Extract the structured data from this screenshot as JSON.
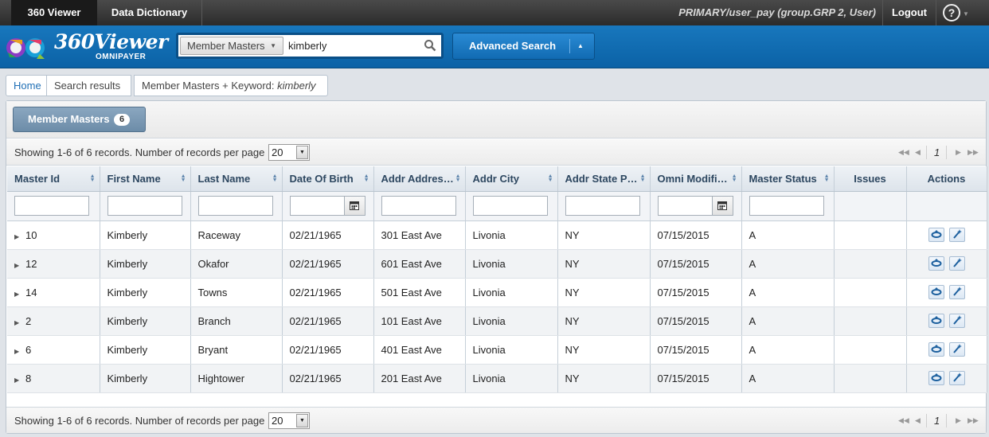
{
  "topbar": {
    "tabs": [
      {
        "label": "360 Viewer"
      },
      {
        "label": "Data Dictionary"
      }
    ],
    "user": "PRIMARY/user_pay (group.GRP 2, User)",
    "logout": "Logout",
    "help_icon": "question-circle-icon"
  },
  "brand": {
    "name": "360Viewer",
    "sub": "OMNIPAYER",
    "colors": {
      "header_blue": "#0f6db4",
      "accent": "#1877bd"
    }
  },
  "search": {
    "scope": "Member Masters",
    "value": "kimberly",
    "placeholder": ""
  },
  "advanced_search": {
    "label": "Advanced Search"
  },
  "breadcrumb": [
    {
      "label": "Home"
    },
    {
      "label": "Search results"
    },
    {
      "label": "Member Masters + Keyword: ",
      "keyword": "kimberly"
    }
  ],
  "tab": {
    "label": "Member Masters",
    "count": "6"
  },
  "pager": {
    "text": "Showing 1-6 of 6 records. Number of records per page",
    "per_page": "20",
    "page": "1"
  },
  "table": {
    "columns": [
      "Master Id",
      "First Name",
      "Last Name",
      "Date Of Birth",
      "Addr Addres…",
      "Addr City",
      "Addr State P…",
      "Omni Modifi…",
      "Master Status",
      "Issues",
      "Actions"
    ],
    "rows": [
      {
        "id": "10",
        "first": "Kimberly",
        "last": "Raceway",
        "dob": "02/21/1965",
        "addr": "301 East Ave",
        "city": "Livonia",
        "state": "NY",
        "modified": "07/15/2015",
        "status": "A",
        "issues": ""
      },
      {
        "id": "12",
        "first": "Kimberly",
        "last": "Okafor",
        "dob": "02/21/1965",
        "addr": "601 East Ave",
        "city": "Livonia",
        "state": "NY",
        "modified": "07/15/2015",
        "status": "A",
        "issues": ""
      },
      {
        "id": "14",
        "first": "Kimberly",
        "last": "Towns",
        "dob": "02/21/1965",
        "addr": "501 East Ave",
        "city": "Livonia",
        "state": "NY",
        "modified": "07/15/2015",
        "status": "A",
        "issues": ""
      },
      {
        "id": "2",
        "first": "Kimberly",
        "last": "Branch",
        "dob": "02/21/1965",
        "addr": "101 East Ave",
        "city": "Livonia",
        "state": "NY",
        "modified": "07/15/2015",
        "status": "A",
        "issues": ""
      },
      {
        "id": "6",
        "first": "Kimberly",
        "last": "Bryant",
        "dob": "02/21/1965",
        "addr": "401 East Ave",
        "city": "Livonia",
        "state": "NY",
        "modified": "07/15/2015",
        "status": "A",
        "issues": ""
      },
      {
        "id": "8",
        "first": "Kimberly",
        "last": "Hightower",
        "dob": "02/21/1965",
        "addr": "201 East Ave",
        "city": "Livonia",
        "state": "NY",
        "modified": "07/15/2015",
        "status": "A",
        "issues": ""
      }
    ],
    "row_actions": [
      "view-360-icon",
      "magic-wand-icon"
    ]
  }
}
